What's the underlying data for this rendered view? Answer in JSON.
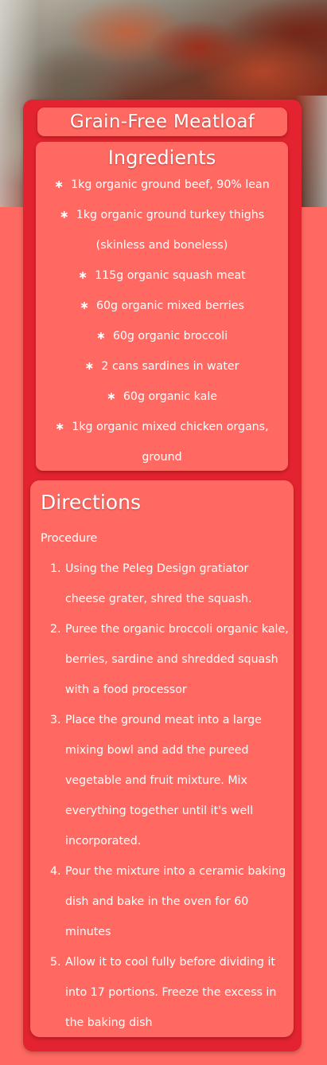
{
  "recipe": {
    "title": "Grain-Free Meatloaf",
    "ingredients_heading": "Ingredients",
    "ingredients": [
      "1kg organic ground beef, 90% lean",
      "1kg organic ground turkey thighs (skinless and boneless)",
      "115g organic squash meat",
      "60g organic mixed berries",
      "60g organic broccoli",
      "2 cans sardines in water",
      "60g organic kale",
      "1kg organic mixed chicken organs, ground"
    ],
    "bullet_symbol": "∗",
    "directions_heading": "Directions",
    "procedure_label": "Procedure",
    "steps": [
      "Using the Peleg Design gratiator cheese grater, shred the squash.",
      "Puree the organic broccoli organic kale, berries, sardine and shredded squash with a food processor",
      "Place the ground meat into a large mixing bowl and add the pureed vegetable and fruit mixture. Mix everything together until it's well incorporated.",
      "Pour the mixture into a ceramic baking dish and bake in the oven for 60 minutes",
      "Allow it to cool fully before dividing it into 17 portions. Freeze the excess in the baking dish"
    ]
  },
  "colors": {
    "page_background": "#ff6961",
    "card_background": "#e3232f",
    "text": "#ffffff"
  }
}
